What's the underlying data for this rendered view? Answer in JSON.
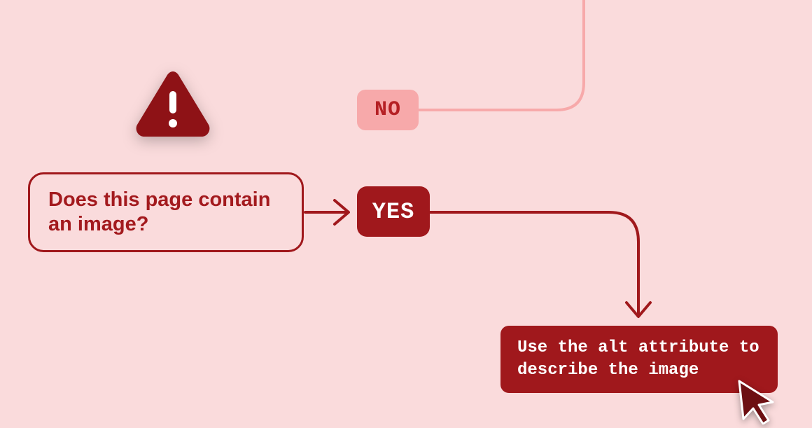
{
  "question": "Does this page contain an image?",
  "answers": {
    "no": "NO",
    "yes": "YES"
  },
  "result": "Use the alt attribute to describe the image",
  "colors": {
    "bg": "#fadbdc",
    "brand_dark": "#a0181c",
    "brand_light": "#f7a9aa",
    "text_on_dark": "#ffffff"
  }
}
